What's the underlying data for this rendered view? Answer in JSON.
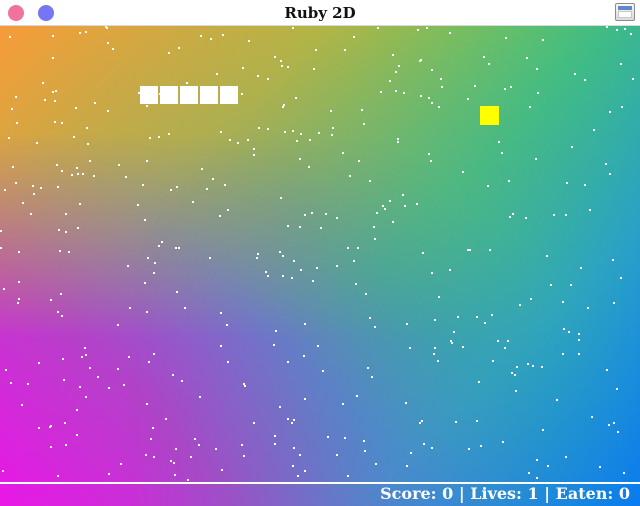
{
  "window": {
    "title": "Ruby 2D",
    "controls": {
      "close_color": "#f0739b",
      "minimize_color": "#7476f2",
      "maximize_icon": "window-maximize-icon"
    }
  },
  "game": {
    "background": {
      "colors": {
        "top_left": "#f69b3b",
        "top_right": "#43cf55",
        "bottom_left": "#f00ef0",
        "bottom_right": "#0a7af0"
      },
      "star_color": "#ffffff"
    },
    "snake": {
      "length": 5,
      "color": "#ffffff"
    },
    "food": {
      "color": "#ffff00"
    },
    "hud": {
      "text": "Score: 0 | Lives: 1 | Eaten: 0"
    }
  }
}
